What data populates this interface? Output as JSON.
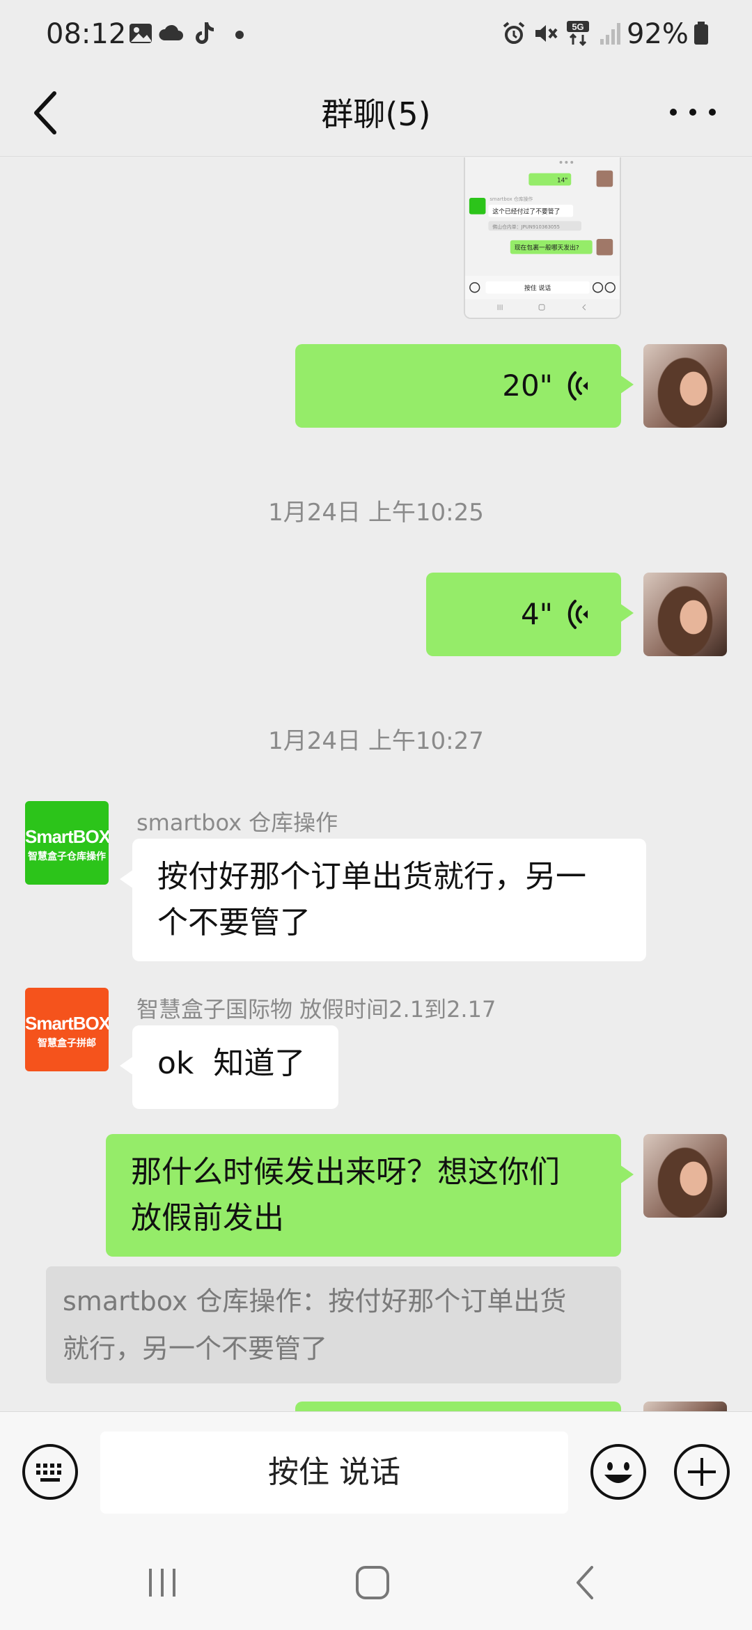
{
  "status_bar": {
    "time": "08:12",
    "battery": "92%",
    "network": "5G",
    "left_icons": [
      "gallery-icon",
      "cloud-icon",
      "tiktok-icon",
      "dot-icon"
    ],
    "right_icons": [
      "alarm-icon",
      "mute-icon",
      "signal-icon",
      "battery-icon"
    ]
  },
  "header": {
    "title": "群聊(5)"
  },
  "messages": {
    "voice1_duration": "20\"",
    "time1": "1月24日 上午10:25",
    "voice2_duration": "4\"",
    "time2": "1月24日 上午10:27",
    "msg3_sender": "smartbox 仓库操作",
    "msg3_text_line1": "按付好那个订单出货就行，另一",
    "msg3_text_line2": "个不要管了",
    "msg4_sender": "智慧盒子国际物 放假时间2.1到2.17",
    "msg4_text": "ok  知道了",
    "msg5_text_line1": "那什么时候发出来呀？想这你们",
    "msg5_text_line2": "放假前发出",
    "quote_line1": "smartbox 仓库操作：按付好那个订单出货",
    "quote_line2": "就行，另一个不要管了"
  },
  "logos": {
    "green": {
      "brand": "SmartBOX",
      "sub": "智慧盒子仓库操作",
      "color": "#2cc41a"
    },
    "orange": {
      "brand": "SmartBOX",
      "sub": "智慧盒子拼邮",
      "color": "#f5531c"
    }
  },
  "thumbnail": {
    "voice_duration": "14\"",
    "sender": "smartbox 仓库操作",
    "msg1": "这个已经付过了不要管了",
    "msg2": "佛山仓内单：JPUN910363055",
    "msg3": "现在包裹一般哪天发出?",
    "input_label": "按住 说话"
  },
  "input_bar": {
    "voice_label": "按住 说话"
  },
  "colors": {
    "my_bubble": "#95ec69",
    "other_bubble": "#ffffff",
    "background": "#ededed"
  }
}
